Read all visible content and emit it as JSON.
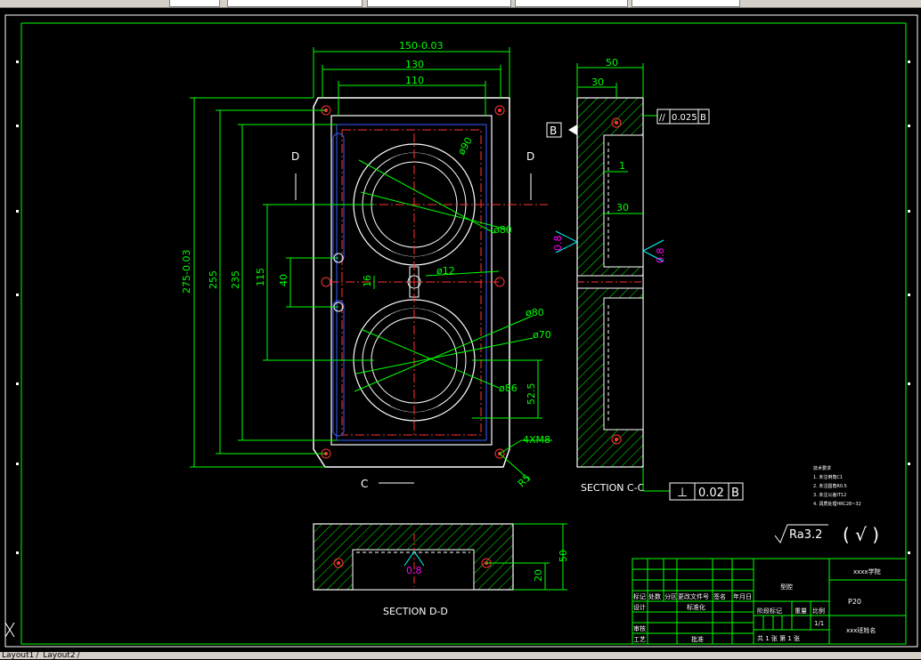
{
  "colors": {
    "background": "#000000",
    "border": "#ffffff",
    "dimension": "#00ff00",
    "outline": "#ffffff",
    "center": "#ff3333",
    "hidden": "#3a5aff",
    "roughness": "#ff00ff",
    "hatch": "#00ff00",
    "cyan": "#00ffff"
  },
  "dims": {
    "w150": "150-0.03",
    "w130": "130",
    "w110": "110",
    "h275": "275-0.03",
    "h255": "255",
    "h235": "235",
    "h115": "115",
    "h40": "40",
    "h16": "16",
    "d90": "ø90",
    "d80a": "ø80",
    "d12": "ø12",
    "d80b": "ø80",
    "d70": "ø70",
    "d86": "ø86",
    "h525": "52.5",
    "m8": "4XM8",
    "r5": "R5",
    "side50": "50",
    "side30": "30",
    "side1": "1",
    "side30b": "30",
    "sec50": "50",
    "sec20": "20"
  },
  "labels": {
    "d_left": "D",
    "d_right": "D",
    "c_bottom": "C",
    "section_cc": "SECTION C-C",
    "section_dd": "SECTION D-D",
    "datum_b": "B",
    "rough_08a": "0.8",
    "rough_08b": "0.8",
    "rough_08c": "0.8"
  },
  "tolerance": {
    "parallel_sym": "//",
    "parallel_val": "0.025",
    "parallel_ref": "B",
    "perp_sym": "⊥",
    "perp_val": "0.02",
    "perp_ref": "B"
  },
  "surface": {
    "ra": "Ra3.2",
    "paren_check": "( √ )"
  },
  "notes": {
    "title": "技术要求",
    "items": [
      "1. 未注倒角C1",
      "2. 未注圆角R0.5",
      "3. 未注公差IT12",
      "4. 调质处理HRC28~32"
    ]
  },
  "title_block": {
    "school": "xxxx学院",
    "part": "型腔",
    "code": "P20",
    "scale": "1/1",
    "name": "xxx班姓名",
    "row_headers": [
      "标记",
      "处数",
      "分区",
      "更改文件号",
      "签名",
      "年月日"
    ],
    "design": "设计",
    "standard": "标准化",
    "review": "审核",
    "process": "工艺",
    "approve": "批准",
    "stage": "阶段标记",
    "weight": "重量",
    "ratio": "比例",
    "sheets": "共 1 张  第 1 张"
  },
  "tabs": [
    "Layout1",
    "Layout2"
  ]
}
